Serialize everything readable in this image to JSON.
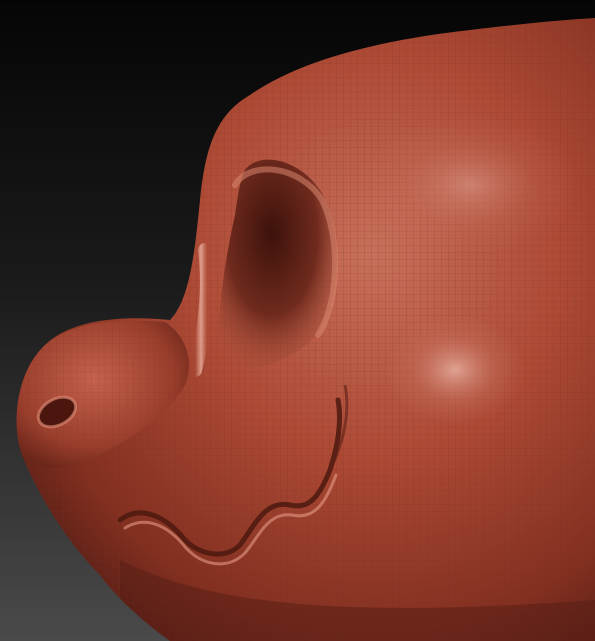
{
  "scene": {
    "subject": "sculpted-snout-model",
    "colors": {
      "background_top": "#050505",
      "background_mid": "#1b1b1b",
      "background_bottom": "#4a4a4a",
      "clay_base": "#a8442f",
      "clay_light": "#c86a55",
      "clay_highlight": "#e7a797",
      "clay_shadow": "#5e2117",
      "wire_line": "#7a2f22"
    }
  }
}
